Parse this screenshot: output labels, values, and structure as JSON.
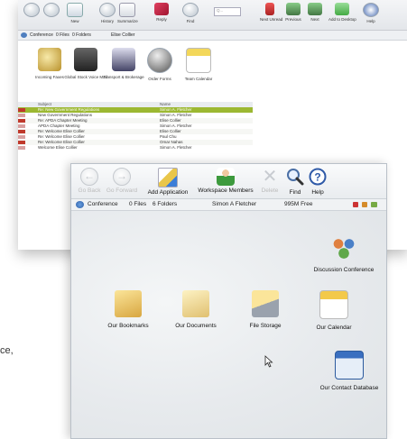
{
  "back_window": {
    "toolbar": [
      {
        "label": "",
        "icon": "back-icon"
      },
      {
        "label": "",
        "icon": "forward-icon"
      },
      {
        "label": "New",
        "icon": "new-document-icon"
      },
      {
        "label": "History",
        "icon": "history-icon"
      },
      {
        "label": "Summarize",
        "icon": "summarize-icon"
      },
      {
        "label": "Reply",
        "icon": "reply-icon"
      },
      {
        "label": "Find",
        "icon": "find-icon"
      },
      {
        "label": "Next Unread",
        "icon": "next-unread-icon"
      },
      {
        "label": "Previous",
        "icon": "previous-icon"
      },
      {
        "label": "Next",
        "icon": "next-icon"
      },
      {
        "label": "Add to Desktop",
        "icon": "add-desktop-icon"
      },
      {
        "label": "Help",
        "icon": "help-icon"
      }
    ],
    "search_placeholder": "Q...",
    "status": {
      "workspace": "Conference",
      "files": "0 Files",
      "folders": "0 Folders",
      "user": "Elise Collier"
    },
    "apps": [
      {
        "label": "Incoming Faxes"
      },
      {
        "label": "Global Stock Voice Mail"
      },
      {
        "label": "Transport & Brokerage"
      },
      {
        "label": "Order Forms"
      },
      {
        "label": "Team Calendar"
      }
    ],
    "mail": {
      "subject_header": "Subject",
      "name_header": "Name",
      "rows": [
        {
          "subject": "Re: New Government Regulations",
          "name": "Simon A. Fletcher",
          "state": "sel"
        },
        {
          "subject": "New Government Regulations",
          "name": "Simon A. Fletcher",
          "state": ""
        },
        {
          "subject": "Re: APDA Chapter Meeting",
          "name": "Elise Collier",
          "state": "alt"
        },
        {
          "subject": "APDA Chapter Meeting",
          "name": "Simon A. Fletcher",
          "state": ""
        },
        {
          "subject": "Re: Welcome Elise Collier",
          "name": "Elise Collier",
          "state": "alt"
        },
        {
          "subject": "Re: Welcome Elise Collier",
          "name": "Paul Chu",
          "state": ""
        },
        {
          "subject": "Re: Welcome Elise Collier",
          "name": "Omar Nahas",
          "state": "alt"
        },
        {
          "subject": "Welcome Elise Collier",
          "name": "Simon A. Fletcher",
          "state": ""
        }
      ]
    }
  },
  "front_window": {
    "toolbar": {
      "go_back": "Go Back",
      "go_forward": "Go Forward",
      "add_application": "Add Application",
      "workspace_members": "Workspace Members",
      "delete": "Delete",
      "find": "Find",
      "help": "Help"
    },
    "status": {
      "workspace": "Conference",
      "files": "0 Files",
      "folders": "6 Folders",
      "user": "Simon A Fletcher",
      "free": "995M Free"
    },
    "tiles": {
      "discussion": "Discussion Conference",
      "bookmarks": "Our Bookmarks",
      "documents": "Our Documents",
      "file_storage": "File Storage",
      "calendar": "Our Calendar",
      "contacts": "Our Contact Database"
    }
  },
  "left_fragment": "ce,"
}
